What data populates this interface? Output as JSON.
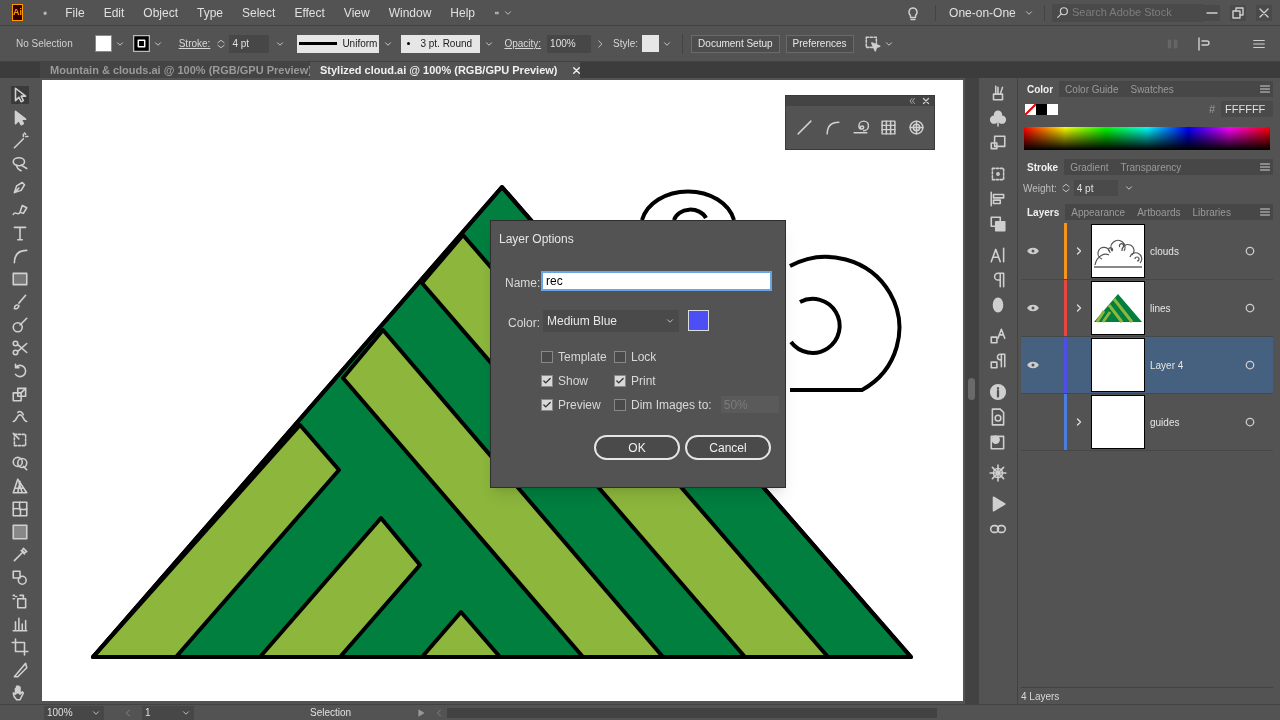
{
  "app_logo": "Ai",
  "menu": [
    "File",
    "Edit",
    "Object",
    "Type",
    "Select",
    "Effect",
    "View",
    "Window",
    "Help"
  ],
  "workspace": "One-on-One",
  "search": {
    "placeholder": "Search Adobe Stock"
  },
  "control_bar": {
    "selection": "No Selection",
    "stroke_label": "Stroke:",
    "stroke_weight": "4 pt",
    "stroke_profile": "Uniform",
    "brush": "3 pt. Round",
    "opacity_label": "Opacity:",
    "opacity": "100%",
    "style_label": "Style:",
    "buttons": [
      "Document Setup",
      "Preferences"
    ]
  },
  "document_tabs": [
    {
      "label": "Mountain & clouds.ai @ 100% (RGB/GPU Preview)",
      "selected": false
    },
    {
      "label": "Stylized cloud.ai @ 100% (RGB/GPU Preview)",
      "selected": true
    }
  ],
  "dialog": {
    "title": "Layer Options",
    "name_label": "Name:",
    "name_value": "rec",
    "color_label": "Color:",
    "color_value": "Medium Blue",
    "color": "#4b4ff5",
    "options": [
      {
        "label": "Template",
        "checked": false
      },
      {
        "label": "Lock",
        "checked": false
      },
      {
        "label": "Show",
        "checked": true
      },
      {
        "label": "Print",
        "checked": true
      },
      {
        "label": "Preview",
        "checked": true
      },
      {
        "label": "Dim Images to:",
        "checked": false
      }
    ],
    "dim_value": {
      "value": "50%",
      "disabled": true
    },
    "buttons": [
      "OK",
      "Cancel"
    ]
  },
  "color_panel": {
    "tabs": [
      {
        "label": "Color",
        "selected": true
      },
      {
        "label": "Color Guide",
        "selected": false
      },
      {
        "label": "Swatches",
        "selected": false
      }
    ],
    "hex_label": "#",
    "hex": "FFFFFF"
  },
  "stroke_panel": {
    "tabs": [
      {
        "label": "Stroke",
        "selected": true
      },
      {
        "label": "Gradient",
        "selected": false
      },
      {
        "label": "Transparency",
        "selected": false
      }
    ],
    "weight_label": "Weight:",
    "weight": "4 pt"
  },
  "layers_panel": {
    "tabs": [
      {
        "label": "Layers",
        "selected": true
      },
      {
        "label": "Appearance",
        "selected": false
      },
      {
        "label": "Artboards",
        "selected": false
      },
      {
        "label": "Libraries",
        "selected": false
      }
    ],
    "layers": [
      {
        "name": "clouds",
        "visible": true,
        "expandable": true,
        "selected": false,
        "color": "#f7941d",
        "kind": "clouds"
      },
      {
        "name": "lines",
        "visible": true,
        "expandable": true,
        "selected": false,
        "color": "#e8473f",
        "kind": "mountain"
      },
      {
        "name": "Layer 4",
        "visible": true,
        "expandable": false,
        "selected": true,
        "color": "#4f4fe8",
        "kind": "blank"
      },
      {
        "name": "guides",
        "visible": false,
        "expandable": true,
        "selected": false,
        "color": "#4a7de0",
        "kind": "blank"
      }
    ],
    "footer": "4 Layers"
  },
  "status_bar": {
    "zoom": "100%",
    "artboard": "1",
    "tool": "Selection"
  }
}
